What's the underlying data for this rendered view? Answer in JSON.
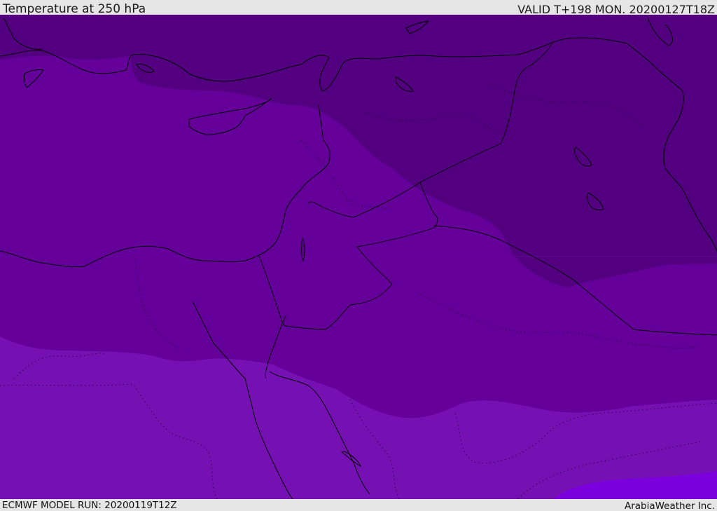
{
  "header": {
    "title": "Temperature at 250 hPa",
    "valid": "VALID T+198 MON. 20200127T18Z"
  },
  "footer": {
    "model_run": "ECMWF MODEL RUN: 20200119T12Z",
    "credit": "ArabiaWeather Inc."
  },
  "map": {
    "field": "temperature",
    "level": "250 hPa",
    "region": "Eastern Mediterranean / Levant / Northern Arabia",
    "colors": {
      "coldest": "#530080",
      "cold": "#640099",
      "mid": "#7510b3",
      "warm": "#7c00de",
      "coastline": "#000000",
      "border": "#000000"
    },
    "contour_bands": 4
  }
}
